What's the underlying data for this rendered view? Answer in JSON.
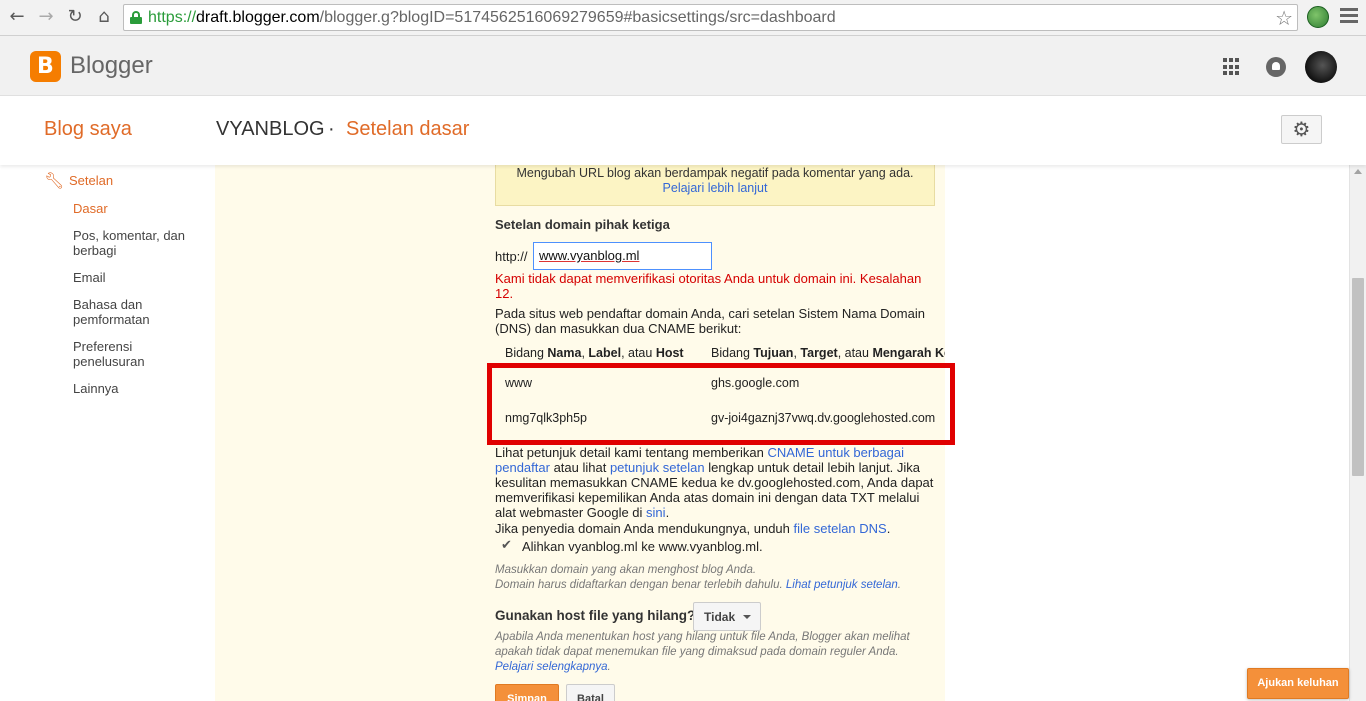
{
  "browser": {
    "url_scheme": "https://",
    "url_host": "draft.blogger.com",
    "url_path": "/blogger.g?blogID=5174562516069279659#basicsettings/src=dashboard"
  },
  "header": {
    "app_name": "Blogger"
  },
  "subheader": {
    "my_blogs": "Blog saya",
    "blog_title": "VYANBLOG",
    "separator": "·",
    "page_title": "Setelan dasar"
  },
  "sidebar": {
    "section": "Setelan",
    "items": [
      {
        "label": "Dasar"
      },
      {
        "label": "Pos, komentar, dan berbagi"
      },
      {
        "label": "Email"
      },
      {
        "label": "Bahasa dan pemformatan"
      },
      {
        "label": "Preferensi penelusuran"
      },
      {
        "label": "Lainnya"
      }
    ]
  },
  "main": {
    "warning_text": "Mengubah URL blog akan berdampak negatif pada komentar yang ada.",
    "warning_link": "Pelajari lebih lanjut",
    "section_label": "Setelan domain pihak ketiga",
    "http_label": "http://",
    "domain_value": "www.vyanblog.ml",
    "error_text": "Kami tidak dapat memverifikasi otoritas Anda untuk domain ini. Kesalahan 12.",
    "dns_intro": "Pada situs web pendaftar domain Anda, cari setelan Sistem Nama Domain (DNS) dan masukkan dua CNAME berikut:",
    "table_header": {
      "col1_pre": "Bidang ",
      "col1_b1": "Nama",
      "col1_mid": ", ",
      "col1_b2": "Label",
      "col1_mid2": ", atau ",
      "col1_b3": "Host",
      "col2_pre": "Bidang ",
      "col2_b1": "Tujuan",
      "col2_mid": ", ",
      "col2_b2": "Target",
      "col2_mid2": ", atau ",
      "col2_b3": "Mengarah Ke"
    },
    "rows": [
      {
        "name": "www",
        "target": "ghs.google.com"
      },
      {
        "name": "nmg7qlk3ph5p",
        "target": "gv-joi4gaznj37vwq.dv.googlehosted.com"
      }
    ],
    "help_p1": "Lihat petunjuk detail kami tentang memberikan",
    "help_link1": "CNAME untuk berbagai pendaftar",
    "help_p2": "atau lihat",
    "help_link2": "petunjuk setelan",
    "help_p3": "lengkap untuk detail lebih lanjut. Jika kesulitan memasukkan CNAME kedua ke dv.googlehosted.com, Anda dapat memverifikasi kepemilikan Anda atas domain ini dengan data TXT melalui alat webmaster Google di",
    "help_link3": "sini",
    "help_p4": ".",
    "dns_file_text": "Jika penyedia domain Anda mendukungnya, unduh",
    "dns_file_link": "file setelan DNS",
    "dns_file_end": ".",
    "redirect_label": "Alihkan vyanblog.ml ke www.vyanblog.ml.",
    "hint1": "Masukkan domain yang akan menghost blog Anda.",
    "hint2": "Domain harus didaftarkan dengan benar terlebih dahulu.",
    "hint2_link": "Lihat petunjuk setelan",
    "hint2_end": ".",
    "missing_host_label": "Gunakan host file yang hilang?",
    "missing_host_value": "Tidak",
    "missing_host_help": "Apabila Anda menentukan host yang hilang untuk file Anda, Blogger akan melihat apakah tidak dapat menemukan file yang dimaksud pada domain reguler Anda.",
    "missing_host_link": "Pelajari selengkapnya",
    "missing_host_end": ".",
    "save_label": "Simpan",
    "cancel_label": "Batal"
  },
  "feedback_label": "Ajukan keluhan",
  "colors": {
    "accent": "#e06b28",
    "error": "#d50000",
    "link": "#3367d6",
    "highlight_frame": "#e00000"
  }
}
